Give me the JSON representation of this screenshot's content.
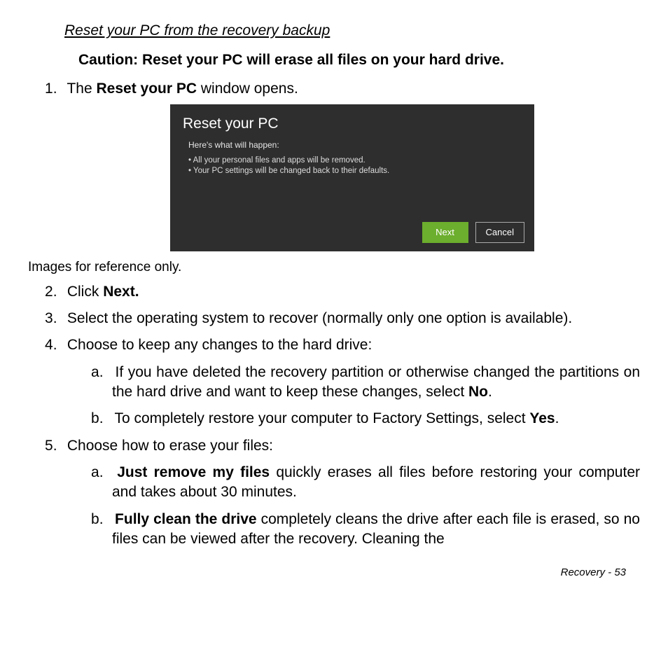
{
  "heading": "Reset your PC from the recovery backup",
  "caution": "Caution: Reset your PC will erase all files on your hard drive.",
  "step1_a": "The ",
  "step1_bold": "Reset your PC",
  "step1_b": " window opens.",
  "screenshot": {
    "title": "Reset your PC",
    "sub": "Here's what will happen:",
    "b1": "All your personal files and apps will be removed.",
    "b2": "Your PC settings will be changed back to their defaults.",
    "next": "Next",
    "cancel": "Cancel"
  },
  "caption": "Images for reference only.",
  "step2_a": "Click ",
  "step2_bold": "Next.",
  "step3": "Select the operating system to recover (normally only one option is available).",
  "step4": "Choose to keep any changes to the hard drive:",
  "step4a_a": "If you have deleted the recovery partition or otherwise changed the partitions on the hard drive and want to keep these changes, select ",
  "step4a_bold": "No",
  "step4a_b": ".",
  "step4b_a": "To completely restore your computer to Factory Settings, select ",
  "step4b_bold": "Yes",
  "step4b_b": ".",
  "step5": "Choose how to erase your files:",
  "step5a_bold": "Just remove my files",
  "step5a_rest": " quickly erases all files before restoring your computer and takes about 30 minutes.",
  "step5b_bold": "Fully clean the drive",
  "step5b_rest": " completely cleans the drive after each file is erased, so no files can be viewed after the recovery. Cleaning the",
  "footer_label": "Recovery -  ",
  "footer_page": "53"
}
